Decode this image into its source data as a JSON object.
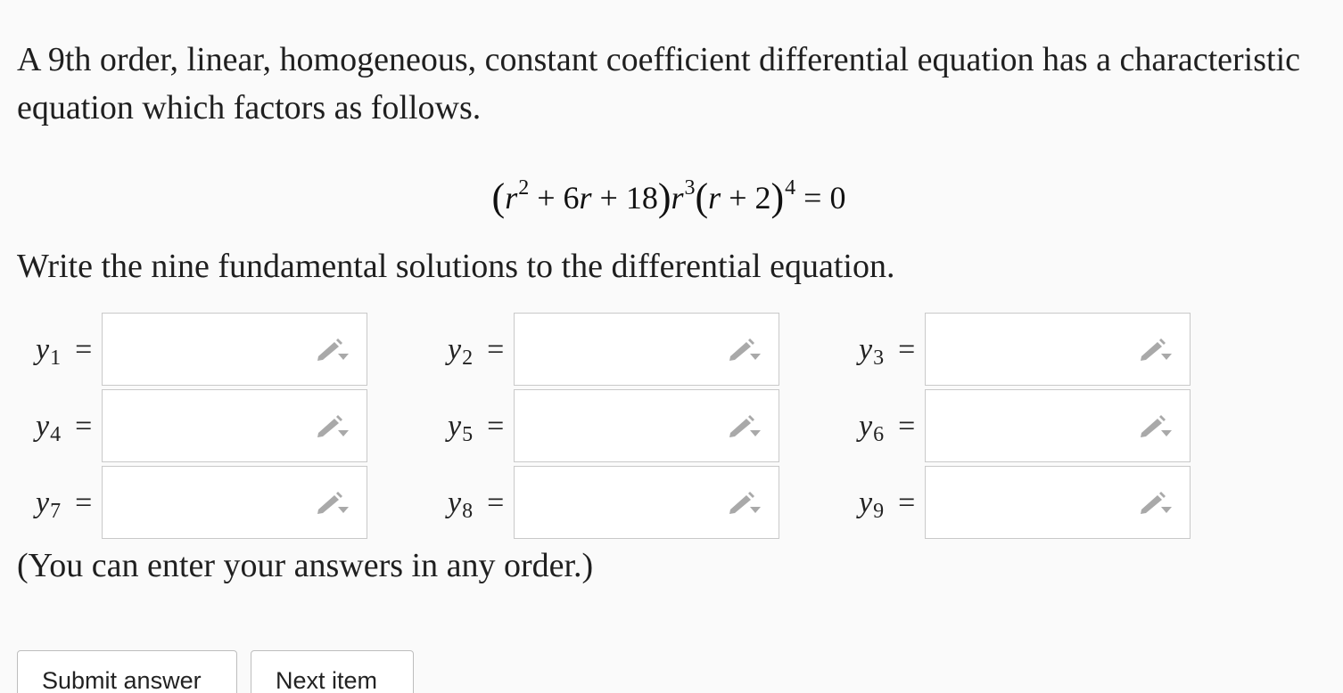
{
  "question": {
    "prompt": "A 9th order, linear, homogeneous, constant coefficient differential equation has a characteristic equation which factors as follows.",
    "equation": {
      "open_paren": "(",
      "r1": "r",
      "exp1": "2",
      "plus1": " + 6",
      "r2": "r",
      "plus2": " + 18",
      "close_paren": ")",
      "r3": "r",
      "exp3": "3",
      "open_paren2": "(",
      "r4": "r",
      "plus3": " + 2",
      "close_paren2": ")",
      "exp4": "4",
      "rhs": " = 0"
    },
    "instruction": "Write the nine fundamental solutions to the differential equation.",
    "footnote": "(You can enter your answers in any order.)"
  },
  "answers": [
    {
      "var": "y",
      "sub": "1",
      "eq": "=",
      "value": ""
    },
    {
      "var": "y",
      "sub": "2",
      "eq": "=",
      "value": ""
    },
    {
      "var": "y",
      "sub": "3",
      "eq": "=",
      "value": ""
    },
    {
      "var": "y",
      "sub": "4",
      "eq": "=",
      "value": ""
    },
    {
      "var": "y",
      "sub": "5",
      "eq": "=",
      "value": ""
    },
    {
      "var": "y",
      "sub": "6",
      "eq": "=",
      "value": ""
    },
    {
      "var": "y",
      "sub": "7",
      "eq": "=",
      "value": ""
    },
    {
      "var": "y",
      "sub": "8",
      "eq": "=",
      "value": ""
    },
    {
      "var": "y",
      "sub": "9",
      "eq": "=",
      "value": ""
    }
  ],
  "icons": {
    "answer_box_icon": "pencil-dropdown-icon"
  },
  "colors": {
    "icon_gray": "#a9a9a9",
    "box_border": "#c9c9c9"
  },
  "buttons": {
    "submit_label": "Submit answer",
    "next_label": "Next item"
  }
}
